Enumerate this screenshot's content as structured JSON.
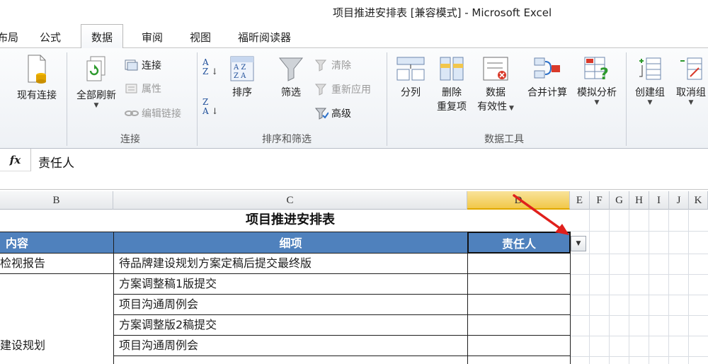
{
  "window": {
    "title": "项目推进安排表  [兼容模式]  -  Microsoft Excel"
  },
  "tabs": [
    {
      "label": "布局",
      "active": false
    },
    {
      "label": "公式",
      "active": false
    },
    {
      "label": "数据",
      "active": true
    },
    {
      "label": "审阅",
      "active": false
    },
    {
      "label": "视图",
      "active": false
    },
    {
      "label": "福昕阅读器",
      "active": false
    }
  ],
  "ribbon": {
    "groups": {
      "external": {
        "existing_connection": "现有连接"
      },
      "connections": {
        "label": "连接",
        "refresh_all": "全部刷新",
        "connections": "连接",
        "properties": "属性",
        "edit_links": "编辑链接"
      },
      "sort_filter": {
        "label": "排序和筛选",
        "sort": "排序",
        "filter": "筛选",
        "clear": "清除",
        "reapply": "重新应用",
        "advanced": "高级"
      },
      "data_tools": {
        "label": "数据工具",
        "text_to_columns": "分列",
        "remove_duplicates_1": "删除",
        "remove_duplicates_2": "重复项",
        "data_validation_1": "数据",
        "data_validation_2": "有效性",
        "consolidate": "合并计算",
        "what_if": "模拟分析"
      },
      "outline": {
        "group": "创建组",
        "ungroup": "取消组"
      }
    }
  },
  "formula_bar": {
    "fx_label": "fx",
    "value": "责任人"
  },
  "columns": [
    "B",
    "C",
    "D",
    "E",
    "F",
    "G",
    "H",
    "I",
    "J",
    "K"
  ],
  "sheet": {
    "title": "项目推进安排表",
    "headers": {
      "content": "内容",
      "detail": "细项",
      "owner": "责任人"
    },
    "rows": [
      {
        "content": "检视报告",
        "detail": "待品牌建设规划方案定稿后提交最终版",
        "owner": ""
      },
      {
        "content": "",
        "detail": "方案调整稿1版提交",
        "owner": ""
      },
      {
        "content": "",
        "detail": "项目沟通周例会",
        "owner": ""
      },
      {
        "content": "",
        "detail": "方案调整版2稿提交",
        "owner": ""
      },
      {
        "content": "建设规划",
        "detail": "项目沟通周例会",
        "owner": ""
      }
    ]
  },
  "colors": {
    "header_fill": "#4f81bd",
    "selected_column": "#f1c84a",
    "annotation_arrow": "#e0201c"
  }
}
